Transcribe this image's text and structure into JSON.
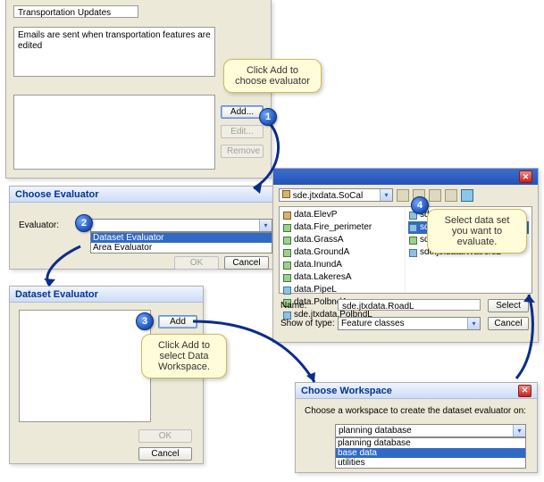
{
  "main_panel": {
    "title_field": "Transportation Updates",
    "message_field": "Emails are sent when transportation features are edited",
    "add_btn": "Add...",
    "edit_btn": "Edit...",
    "remove_btn": "Remove"
  },
  "choose_evaluator": {
    "title": "Choose Evaluator",
    "label": "Evaluator:",
    "selected": "Dataset Evaluator",
    "option2": "Area Evaluator",
    "ok": "OK",
    "cancel": "Cancel"
  },
  "dataset_eval": {
    "title": "Dataset Evaluator",
    "add": "Add",
    "ok": "OK",
    "cancel": "Cancel"
  },
  "browse": {
    "lookin_value": "sde.jtxdata.SoCal",
    "col1": [
      "data.ElevP",
      "data.Fire_perimeter",
      "data.GrassA",
      "data.GroundA",
      "data.InundA",
      "data.LakeresA",
      "data.PipeL",
      "data.PolbndA",
      "sde.jtxdata.PolbndL"
    ],
    "col2": [
      "sde.jtxdata.RailrdL",
      "sde.jtxdata.RoadL",
      "sde.jtxdata.TreesA",
      "sde.jtxdata.WatrcrsL"
    ],
    "col2_sel_index": 1,
    "name_label": "Name:",
    "name_value": "sde.jtxdata.RoadL",
    "showtype_label": "Show of type:",
    "showtype_value": "Feature classes",
    "select_btn": "Select",
    "cancel_btn": "Cancel"
  },
  "choose_workspace": {
    "title": "Choose Workspace",
    "prompt": "Choose a workspace to create the dataset evaluator on:",
    "selected": "planning database",
    "options": [
      "planning database",
      "base data",
      "utilities"
    ]
  },
  "callouts": {
    "c1": "Click Add to choose evaluator",
    "c3": "Click Add to select Data Workspace.",
    "c4": "Select data set you want to evaluate."
  },
  "steps": {
    "s1": "1",
    "s2": "2",
    "s3": "3",
    "s4": "4"
  }
}
